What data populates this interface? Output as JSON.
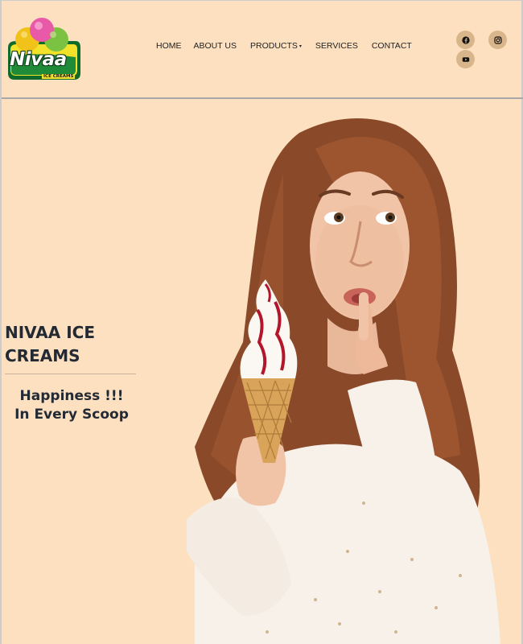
{
  "brand": {
    "logo_word": "Nivaa",
    "logo_sub": "ICE CREAMS",
    "logo_icon": "ice-cream-scoops-logo"
  },
  "nav": {
    "items": [
      {
        "label": "HOME"
      },
      {
        "label": "ABOUT US"
      },
      {
        "label": "PRODUCTS",
        "has_dropdown": true
      },
      {
        "label": "SERVICES"
      },
      {
        "label": "CONTACT"
      }
    ],
    "caret": "▾"
  },
  "social": {
    "icons": [
      "facebook-icon",
      "instagram-icon",
      "youtube-icon"
    ]
  },
  "hero": {
    "title": "NIVAA ICE CREAMS",
    "tagline_line1": "Happiness !!!",
    "tagline_line2": "In Every Scoop",
    "image": "woman-holding-ice-cream-cone"
  },
  "colors": {
    "background": "#fde0c0",
    "text_dark": "#232a33",
    "social_circle": "#d9b58c"
  }
}
